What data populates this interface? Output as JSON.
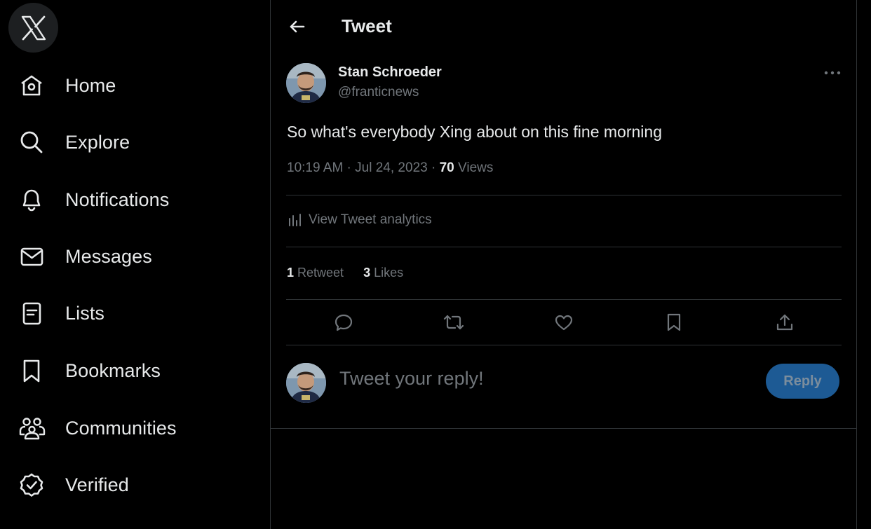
{
  "sidebar": {
    "logo_icon": "x-logo-icon",
    "items": [
      {
        "label": "Home",
        "icon": "home-icon"
      },
      {
        "label": "Explore",
        "icon": "search-icon"
      },
      {
        "label": "Notifications",
        "icon": "bell-icon"
      },
      {
        "label": "Messages",
        "icon": "envelope-icon"
      },
      {
        "label": "Lists",
        "icon": "list-icon"
      },
      {
        "label": "Bookmarks",
        "icon": "bookmark-icon"
      },
      {
        "label": "Communities",
        "icon": "people-icon"
      },
      {
        "label": "Verified",
        "icon": "verified-badge-icon"
      }
    ]
  },
  "header": {
    "title": "Tweet",
    "back_icon": "arrow-left-icon"
  },
  "tweet": {
    "author_name": "Stan Schroeder",
    "author_handle": "@franticnews",
    "text": "So what's everybody Xing about on this fine morning",
    "time": "10:19 AM",
    "date": "Jul 24, 2023",
    "views_count": "70",
    "views_label": "Views",
    "analytics_label": "View Tweet analytics",
    "retweets_count": "1",
    "retweets_label": "Retweet",
    "likes_count": "3",
    "likes_label": "Likes",
    "actions": [
      "reply-icon",
      "retweet-icon",
      "like-icon",
      "bookmark-icon",
      "share-icon"
    ]
  },
  "reply": {
    "placeholder": "Tweet your reply!",
    "button_label": "Reply"
  },
  "colors": {
    "background": "#000000",
    "text": "#e7e9ea",
    "muted": "#71767b",
    "border": "#2f3336",
    "reply_button": "#1d5a94"
  }
}
